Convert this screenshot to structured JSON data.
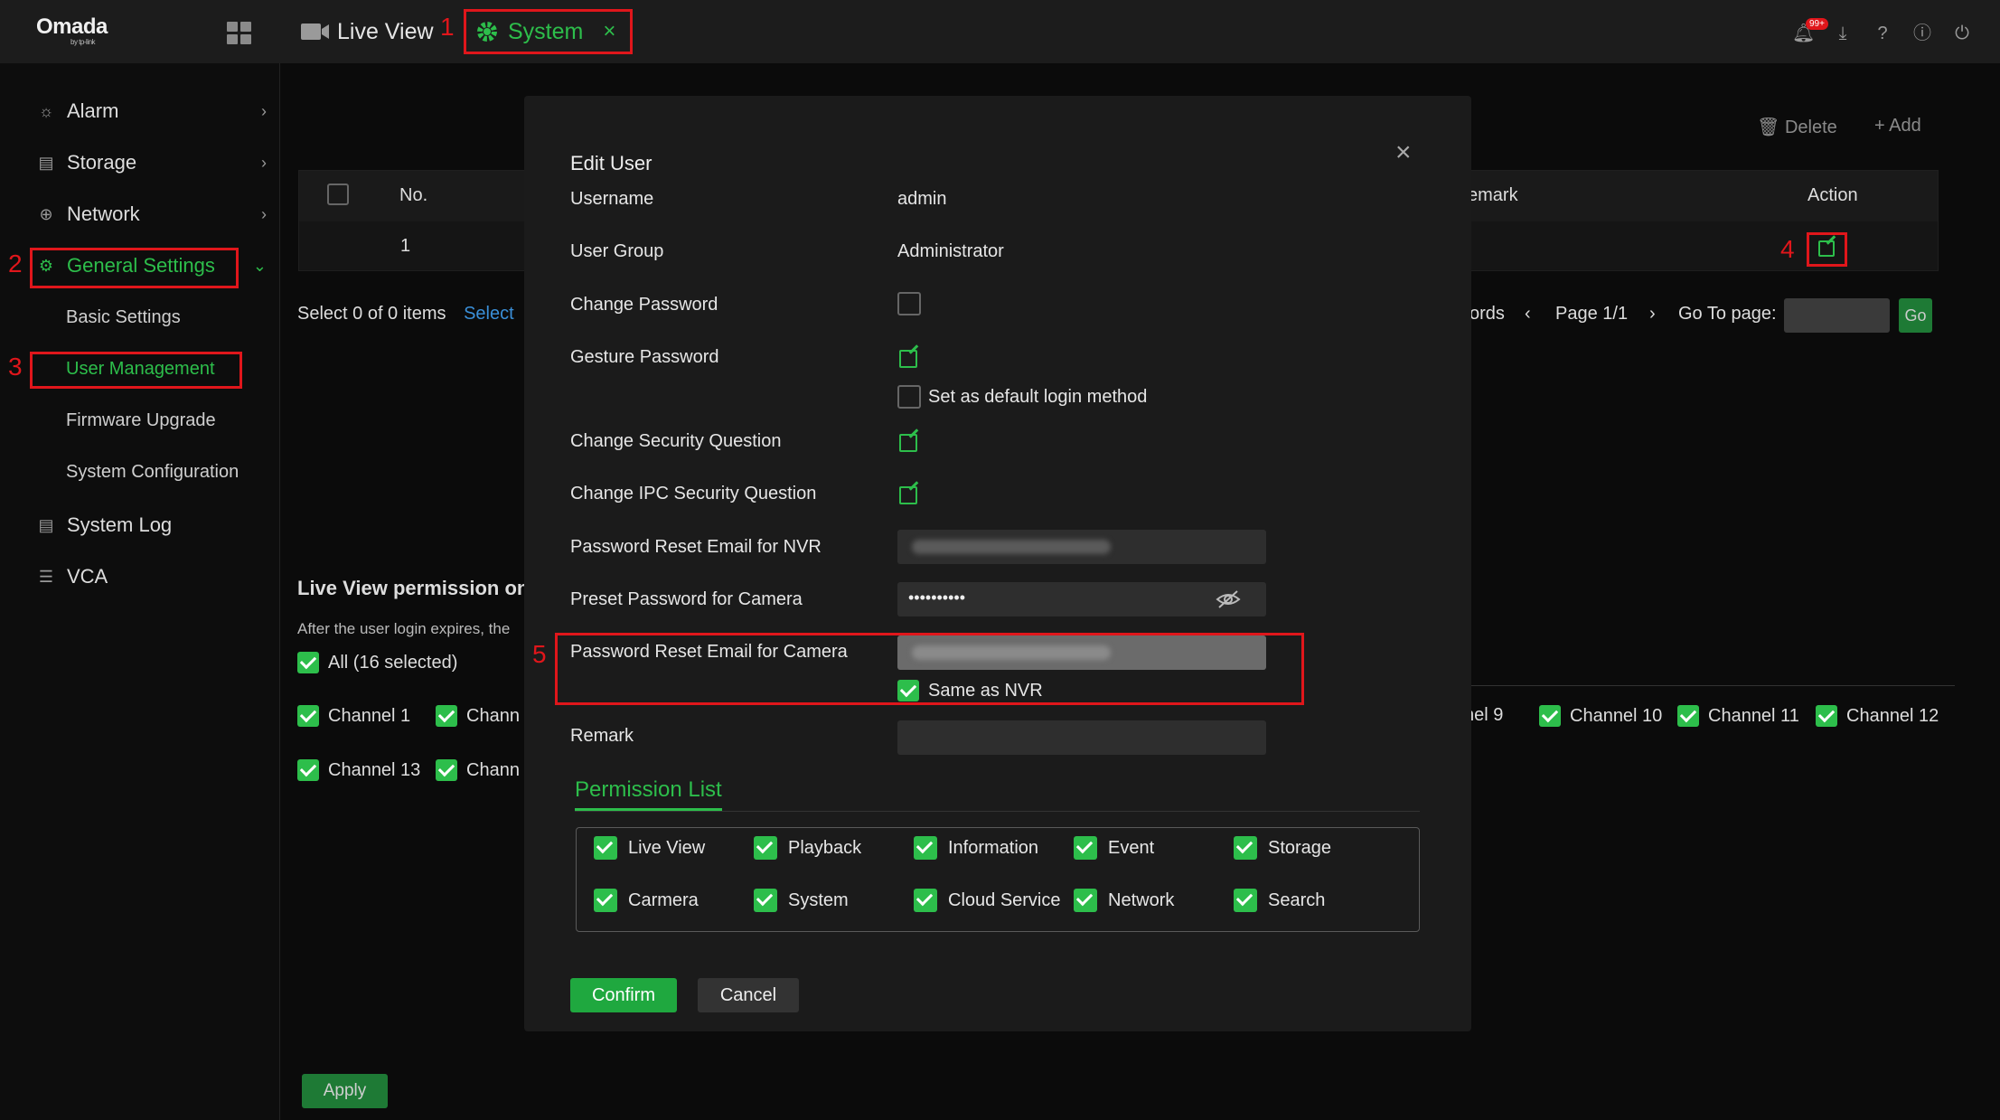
{
  "app": {
    "logo": "Omada",
    "logo_sub": "by tp-link",
    "notification_badge": "99+"
  },
  "tabs": {
    "live_view": "Live View",
    "system": "System",
    "close": "×"
  },
  "annotations": [
    "1",
    "2",
    "3",
    "4",
    "5"
  ],
  "sidebar": {
    "alarm": "Alarm",
    "storage": "Storage",
    "network": "Network",
    "general_settings": "General Settings",
    "basic_settings": "Basic Settings",
    "user_management": "User Management",
    "firmware_upgrade": "Firmware Upgrade",
    "system_configuration": "System Configuration",
    "system_log": "System Log",
    "vca": "VCA"
  },
  "main": {
    "delete": "Delete",
    "add": "Add",
    "table": {
      "col_no": "No.",
      "col_remark": "emark",
      "col_action": "Action",
      "row_no": "1"
    },
    "select_info": "Select 0 of 0 items",
    "select_link": "Select",
    "pagination": {
      "records": "ords",
      "page": "Page 1/1",
      "go_to": "Go To page:",
      "go": "Go"
    },
    "live_view_permission": "Live View permission on L",
    "expire_note": "After the user login expires, the",
    "all_selected": "All  (16 selected)",
    "channels_row1": [
      "Channel 1",
      "Chann",
      "nel 9",
      "Channel 10",
      "Channel 11",
      "Channel 12"
    ],
    "channels_row2": [
      "Channel 13",
      "Chann"
    ],
    "apply": "Apply"
  },
  "modal": {
    "title": "Edit User",
    "username_label": "Username",
    "username_value": "admin",
    "user_group_label": "User Group",
    "user_group_value": "Administrator",
    "change_password_label": "Change Password",
    "gesture_password_label": "Gesture Password",
    "default_login": "Set as default login method",
    "change_security_label": "Change Security Question",
    "change_ipc_security_label": "Change IPC Security Question",
    "reset_email_nvr_label": "Password Reset Email for NVR",
    "preset_password_label": "Preset Password for Camera",
    "preset_password_value": "••••••••••",
    "reset_email_camera_label": "Password Reset Email for Camera",
    "same_as_nvr": "Same as NVR",
    "remark_label": "Remark",
    "permission_list": "Permission List",
    "permissions": [
      "Live View",
      "Playback",
      "Information",
      "Event",
      "Storage",
      "Carmera",
      "System",
      "Cloud Service",
      "Network",
      "Search"
    ],
    "confirm": "Confirm",
    "cancel": "Cancel",
    "close": "×"
  },
  "colors": {
    "accent": "#2dbe4b",
    "annotation": "#e0161b"
  }
}
